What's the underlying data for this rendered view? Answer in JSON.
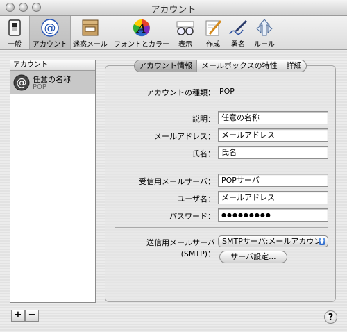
{
  "window": {
    "title": "アカウント"
  },
  "toolbar": {
    "items": [
      {
        "label": "一般",
        "icon": "switch-icon"
      },
      {
        "label": "アカウント",
        "icon": "at-sign-icon"
      },
      {
        "label": "迷惑メール",
        "icon": "junk-mail-icon"
      },
      {
        "label": "フォントとカラー",
        "icon": "font-color-icon"
      },
      {
        "label": "表示",
        "icon": "glasses-icon"
      },
      {
        "label": "作成",
        "icon": "compose-pencil-icon"
      },
      {
        "label": "署名",
        "icon": "signature-pen-icon"
      },
      {
        "label": "ルール",
        "icon": "rules-icon"
      }
    ],
    "selected": "アカウント"
  },
  "sidebar": {
    "header": "アカウント",
    "accounts": [
      {
        "name": "任意の名称",
        "type": "POP"
      }
    ],
    "add_label": "+",
    "remove_label": "−"
  },
  "tabs": [
    "アカウント情報",
    "メールボックスの特性",
    "詳細"
  ],
  "account_info": {
    "type_label": "アカウントの種類：",
    "type_value": "POP",
    "description_label": "説明：",
    "description_value": "任意の名称",
    "email_label": "メールアドレス：",
    "email_value": "メールアドレス",
    "fullname_label": "氏名：",
    "fullname_value": "氏名",
    "incoming_label": "受信用メールサーバ：",
    "incoming_value": "POPサーバ",
    "username_label": "ユーザ名：",
    "username_value": "メールアドレス",
    "password_label": "パスワード：",
    "password_value": "●●●●●●●●●",
    "smtp_label": "送信用メールサーバ (SMTP)：",
    "smtp_value": "SMTPサーバ:メールアカウン",
    "server_settings_label": "サーバ設定..."
  },
  "help_label": "?",
  "colors": {
    "accent": "#2a66c8",
    "selection": "#c8c8c8"
  }
}
